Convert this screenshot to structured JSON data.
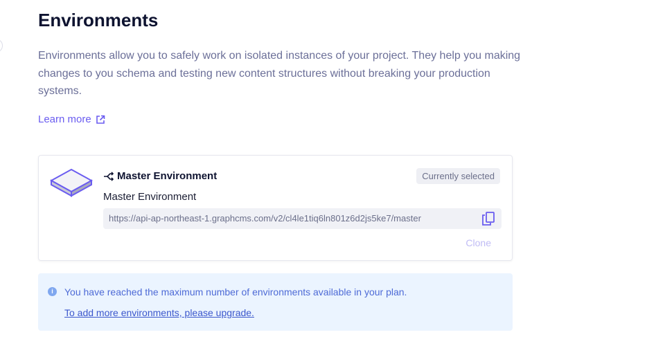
{
  "page": {
    "title": "Environments",
    "description": "Environments allow you to safely work on isolated instances of your project. They help you making changes to you schema and testing new content structures without breaking your production systems.",
    "learn_more": "Learn more"
  },
  "environment": {
    "title": "Master Environment",
    "badge": "Currently selected",
    "name": "Master Environment",
    "url": "https://api-ap-northeast-1.graphcms.com/v2/cl4le1tiq6ln801z6d2js5ke7/master",
    "clone_label": "Clone"
  },
  "notice": {
    "message": "You have reached the maximum number of environments available in your plan.",
    "link": "To add more environments, please upgrade."
  },
  "colors": {
    "accent": "#6a5cf0",
    "info_bg": "#ebf4ff"
  }
}
